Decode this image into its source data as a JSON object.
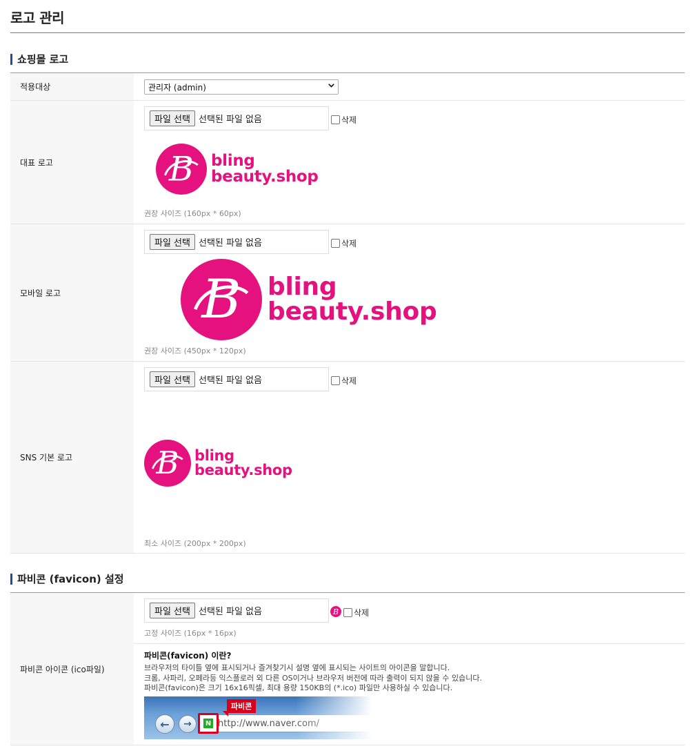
{
  "page": {
    "title": "로고 관리"
  },
  "shop_logo": {
    "heading": "쇼핑몰 로고",
    "target": {
      "label": "적용대상",
      "selected": "관리자 (admin)"
    },
    "file": {
      "button": "파일 선택",
      "status": "선택된 파일 없음",
      "delete": "삭제"
    },
    "logo_text": {
      "line1": "bling",
      "line2": "beauty.shop"
    },
    "rep_logo": {
      "label": "대표 로고",
      "hint": "권장 사이즈 (160px * 60px)"
    },
    "mobile_logo": {
      "label": "모바일 로고",
      "hint": "권장 사이즈 (450px * 120px)"
    },
    "sns_logo": {
      "label": "SNS 기본 로고",
      "hint": "최소 사이즈 (200px * 200px)"
    }
  },
  "favicon": {
    "heading": "파비콘 (favicon) 설정",
    "label": "파비콘 아이콘 (ico파일)",
    "file": {
      "button": "파일 선택",
      "status": "선택된 파일 없음",
      "delete": "삭제"
    },
    "hint": "고정 사이즈 (16px * 16px)",
    "faq_title": "파비콘(favicon) 이란?",
    "faq_line1": "브라우저의 타이틀 옆에 표시되거나 즐겨찾기시 설명 옆에 표시되는 사이트의 아이콘을 말합니다.",
    "faq_line2": "크롬, 사파리, 오페라등 익스플로러 외 다른 OS이거나 브라우저 버전에 따라 출력이 되지 않을 수 있습니다.",
    "faq_line3": "파비콘(favicon)은 크기 16x16픽셀, 최대 용량 150KB의 (*.ico) 파일만 사용하실 수 있습니다.",
    "example": {
      "tag": "파비콘",
      "url": "http://www.naver.com/",
      "n_letter": "N"
    }
  },
  "colors": {
    "brand": "#e4117e",
    "accent": "#1e4f9c",
    "highlight": "#d6001c"
  }
}
